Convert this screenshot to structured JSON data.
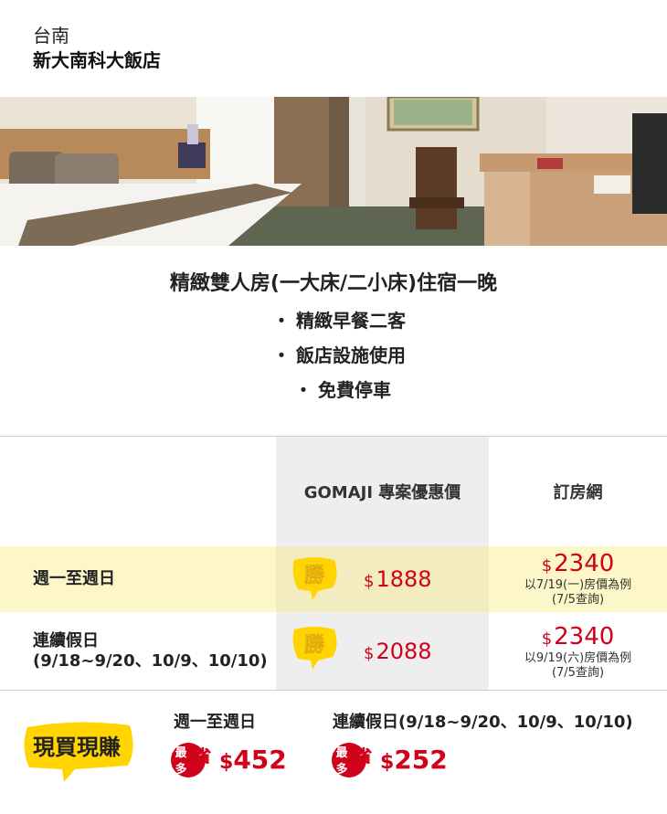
{
  "header": {
    "city": "台南",
    "hotel_name": "新大南科大飯店"
  },
  "package": {
    "title": "精緻雙人房(一大床/二小床)住宿一晚",
    "items": [
      "精緻早餐二客",
      "飯店設施使用",
      "免費停車"
    ],
    "bullet": "・"
  },
  "table": {
    "col_gomaji": "GOMAJI 專案優惠價",
    "col_booking": "訂房網",
    "win_badge": "勝",
    "currency": "$",
    "rows": [
      {
        "label": "週一至週日",
        "label_line2": "",
        "gomaji_price": "1888",
        "booking_price": "2340",
        "booking_note1": "以7/19(一)房價為例",
        "booking_note2": "(7/5查詢)"
      },
      {
        "label": "連續假日",
        "label_line2": "(9/18~9/20、10/9、10/10)",
        "gomaji_price": "2088",
        "booking_price": "2340",
        "booking_note1": "以9/19(六)房價為例",
        "booking_note2": "(7/5查詢)"
      }
    ]
  },
  "summary": {
    "badge_text": "現買現賺",
    "save_badge_top": "最",
    "save_badge_bottom": "多",
    "save_badge_main": "省",
    "currency": "$",
    "items": [
      {
        "label": "週一至週日",
        "amount": "452"
      },
      {
        "label": "連續假日(9/18~9/20、10/9、10/10)",
        "amount": "252"
      }
    ]
  },
  "colors": {
    "highlight_row": "#fdf6c8",
    "gomaji_col": "#eeeeee",
    "price_red": "#d0021b",
    "badge_yellow": "#ffd400"
  }
}
